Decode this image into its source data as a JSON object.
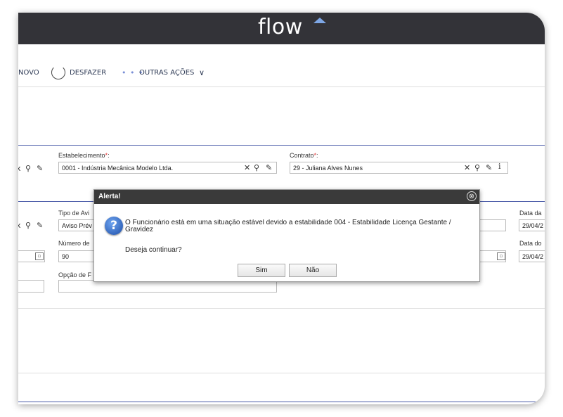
{
  "header": {
    "logo_text": "flow"
  },
  "toolbar": {
    "novo_label": "NOVO",
    "undo_label": "DESFAZER",
    "more_label": "OUTRAS AÇÕES"
  },
  "form": {
    "estab_label": "Estabelecimento",
    "estab_value": "0001 - Indústria Mecânica Modelo Ltda.",
    "contrato_label": "Contrato",
    "contrato_value": "29 - Juliana Alves Nunes",
    "tipo_label": "Tipo de Avi",
    "tipo_value": "Aviso Prév",
    "numero_label": "Número de",
    "numero_value": "90",
    "opcao_label": "Opção de F",
    "data1_label": "Data da",
    "data1_value": "29/04/2",
    "data2_label": "Data do",
    "data2_value": "29/04/2",
    "required_mark": "*",
    "colon": ":"
  },
  "dialog": {
    "title": "Alerta!",
    "message": "O Funcionário está em uma situação estável devido a estabilidade 004 - Estabilidade Licença Gestante / Gravidez",
    "question": "Deseja continuar?",
    "yes_label": "Sim",
    "no_label": "Não",
    "close_symbol": "⊗"
  },
  "colors": {
    "topbar": "#333338",
    "accent": "#7ea7e6",
    "section_line": "#4a5ba8"
  }
}
